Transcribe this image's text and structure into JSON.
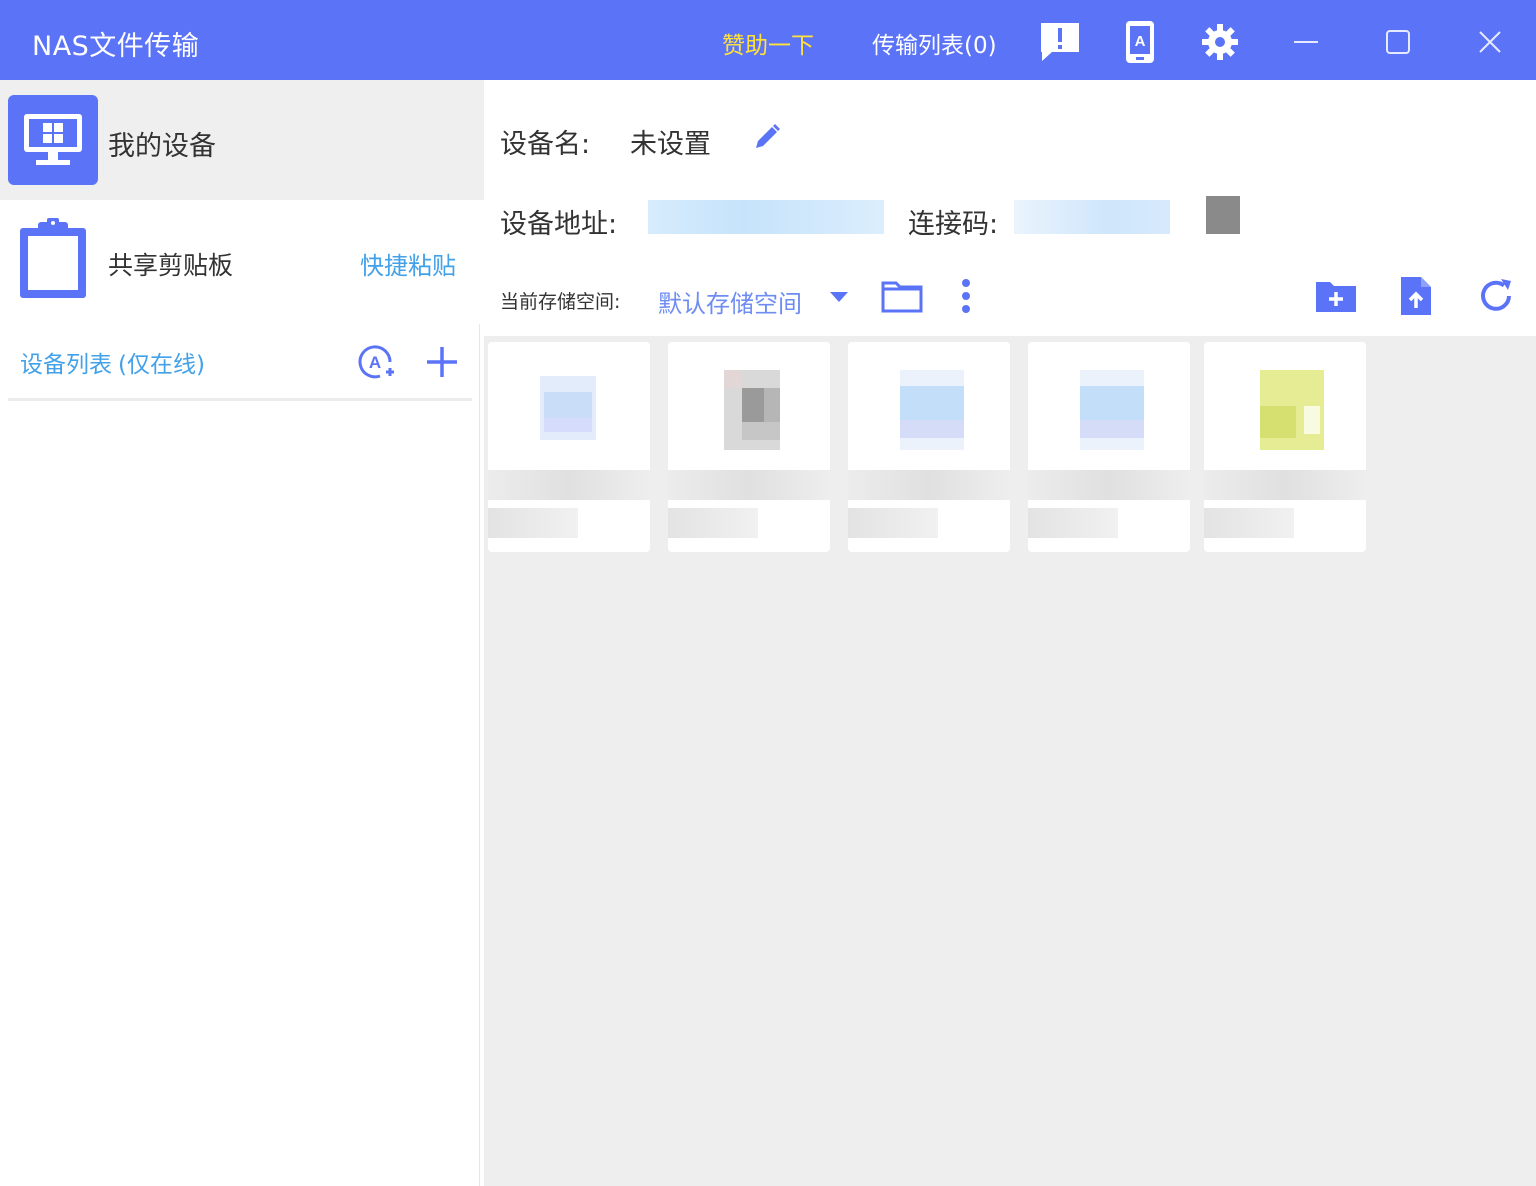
{
  "titlebar": {
    "app_title": "NAS文件传输",
    "sponsor_label": "赞助一下",
    "transfer_list_label": "传输列表(0)",
    "icons": [
      "feedback-icon",
      "phone-icon",
      "gear-icon",
      "minimize-icon",
      "maximize-icon",
      "close-icon"
    ]
  },
  "sidebar": {
    "my_device_label": "我的设备",
    "clipboard_label": "共享剪贴板",
    "quick_paste_label": "快捷粘贴",
    "device_list_label": "设备列表",
    "device_list_sub": "(仅在线)"
  },
  "info": {
    "device_name_label": "设备名:",
    "device_name_value": "未设置",
    "device_addr_label": "设备地址:",
    "conn_code_label": "连接码:",
    "storage_label": "当前存储空间:",
    "storage_value": "默认存储空间"
  },
  "colors": {
    "accent": "#5b73f7",
    "link": "#42a1e8",
    "sponsor": "#ffe33b"
  },
  "files": [
    {
      "thumb": "image"
    },
    {
      "thumb": "archive"
    },
    {
      "thumb": "image"
    },
    {
      "thumb": "image"
    },
    {
      "thumb": "document"
    }
  ]
}
